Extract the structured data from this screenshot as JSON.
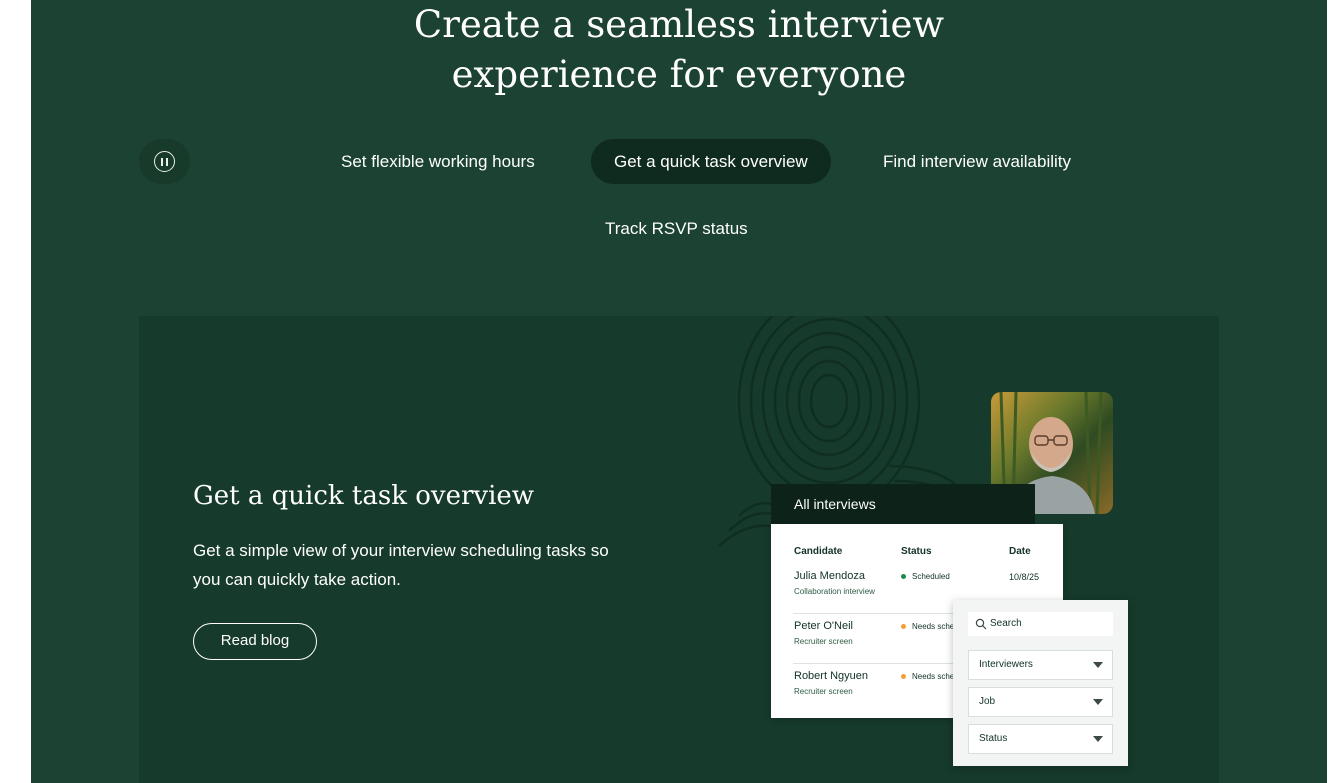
{
  "hero": {
    "title_line1": "Create a seamless interview",
    "title_line2": "experience for everyone"
  },
  "tabs": [
    {
      "label": "Set flexible working hours",
      "active": false
    },
    {
      "label": "Get a quick task overview",
      "active": true
    },
    {
      "label": "Find interview availability",
      "active": false
    },
    {
      "label": "Track RSVP status",
      "active": false
    }
  ],
  "feature": {
    "title": "Get a quick task overview",
    "description": "Get a simple view of your interview scheduling tasks so you can quickly take action.",
    "cta_label": "Read blog"
  },
  "interviews_panel": {
    "header": "All interviews",
    "columns": [
      "Candidate",
      "Status",
      "Date"
    ],
    "rows": [
      {
        "name": "Julia Mendoza",
        "subtitle": "Collaboration interview",
        "status": "Scheduled",
        "status_color": "#1c8a4e",
        "date": "10/8/25"
      },
      {
        "name": "Peter O'Neil",
        "subtitle": "Recruiter screen",
        "status": "Needs sche",
        "status_color": "#f0a030",
        "date": ""
      },
      {
        "name": "Robert Ngyuen",
        "subtitle": "Recruiter screen",
        "status": "Needs sche",
        "status_color": "#f0a030",
        "date": ""
      }
    ]
  },
  "filters": {
    "search_placeholder": "Search",
    "dropdowns": [
      "Interviewers",
      "Job",
      "Status"
    ]
  },
  "colors": {
    "section_bg": "#1b4232",
    "card_bg": "#163a2b",
    "active_tab_bg": "#0f2a1f"
  }
}
